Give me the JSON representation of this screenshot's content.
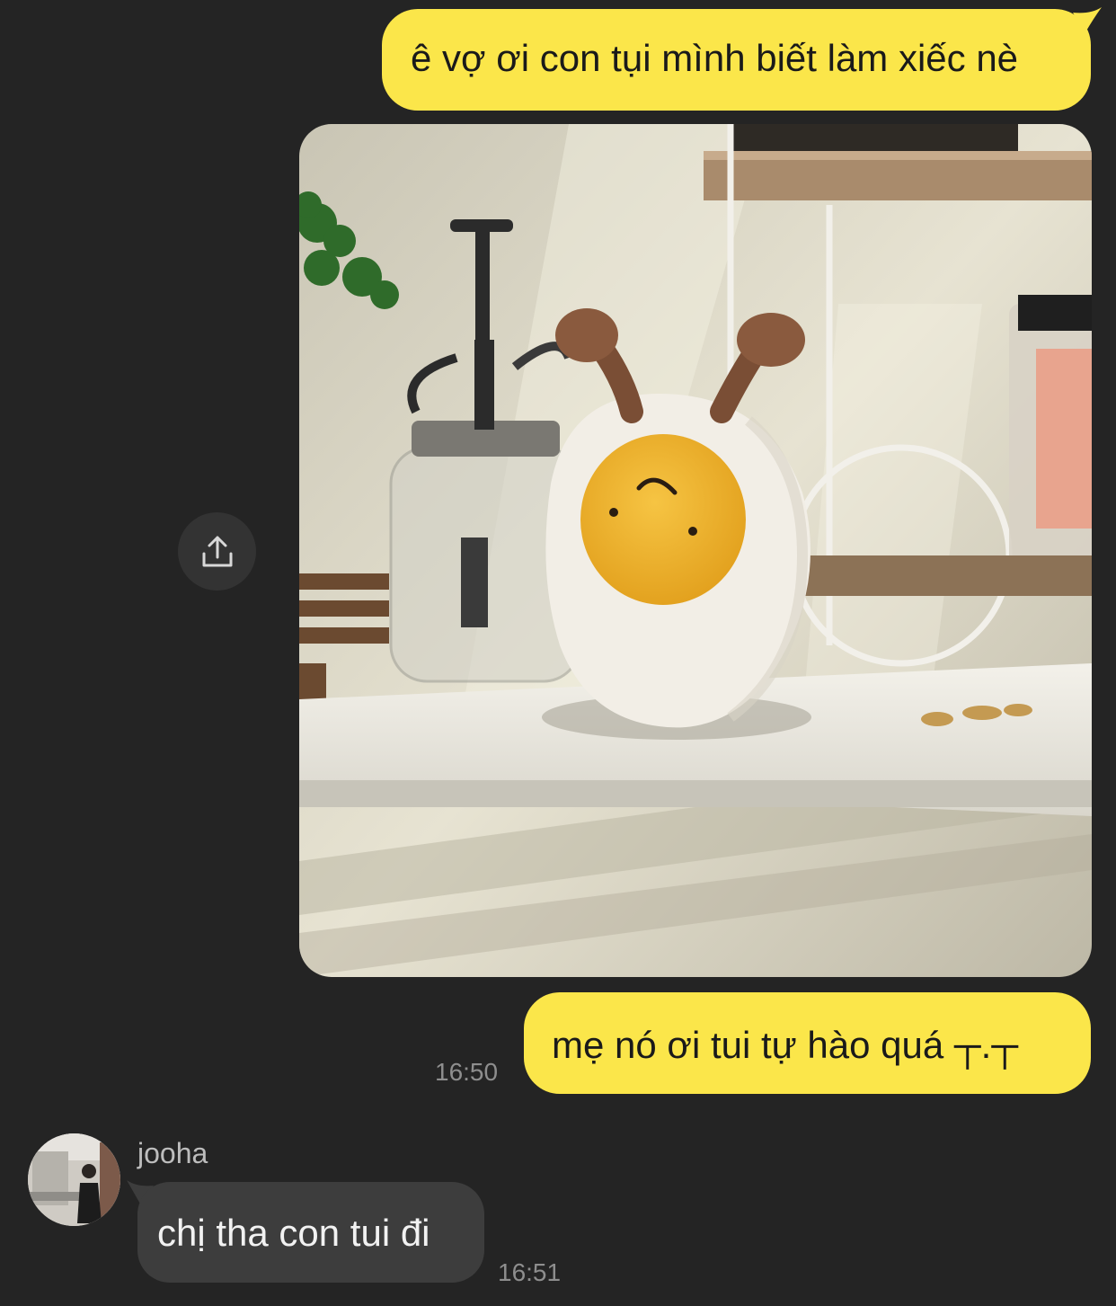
{
  "messages": [
    {
      "from": "me",
      "text": "ê vợ ơi con tụi mình biết làm xiếc nè"
    },
    {
      "from": "me",
      "type": "photo",
      "image": "egg-plush-on-shelf"
    },
    {
      "from": "me",
      "text": "mẹ nó ơi tui tự hào quá ┬.┬",
      "time": "16:50"
    },
    {
      "from": "jooha",
      "sender_name": "jooha",
      "text": "chị tha con tui đi",
      "time": "16:51"
    }
  ],
  "icons": {
    "share": "share-upload-icon"
  },
  "colors": {
    "background": "#242424",
    "outgoing_bubble": "#fbe64a",
    "incoming_bubble": "#3d3d3d",
    "timestamp": "#8e8e8e"
  }
}
